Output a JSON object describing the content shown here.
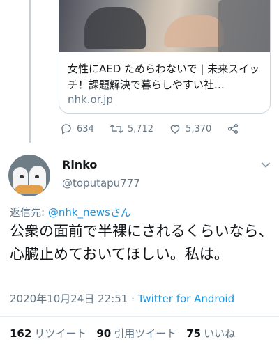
{
  "card": {
    "title": "女性にAED ためらわないで | 未来スイッチ！課題解決で暮らしやすい社…",
    "domain": "nhk.or.jp"
  },
  "actions": {
    "replies": "634",
    "retweets": "5,712",
    "likes": "5,370"
  },
  "tweet": {
    "name": "Rinko",
    "handle": "@toputapu777",
    "reply_prefix": "返信先: ",
    "reply_link": "@nhk_newsさん",
    "text": "公衆の面前で半裸にされるくらいなら、心臓止めておいてほしい。私は。",
    "timestamp": "2020年10月24日 22:51 · ",
    "source": "Twitter for Android"
  },
  "stats": {
    "retweets_count": "162",
    "retweets_label": "リツイート",
    "quotes_count": "90",
    "quotes_label": "引用ツイート",
    "likes_count": "75",
    "likes_label": "いいね"
  },
  "colors": {
    "link": "#1b95e0",
    "secondary_text": "#657786",
    "primary_text": "#14171a"
  }
}
